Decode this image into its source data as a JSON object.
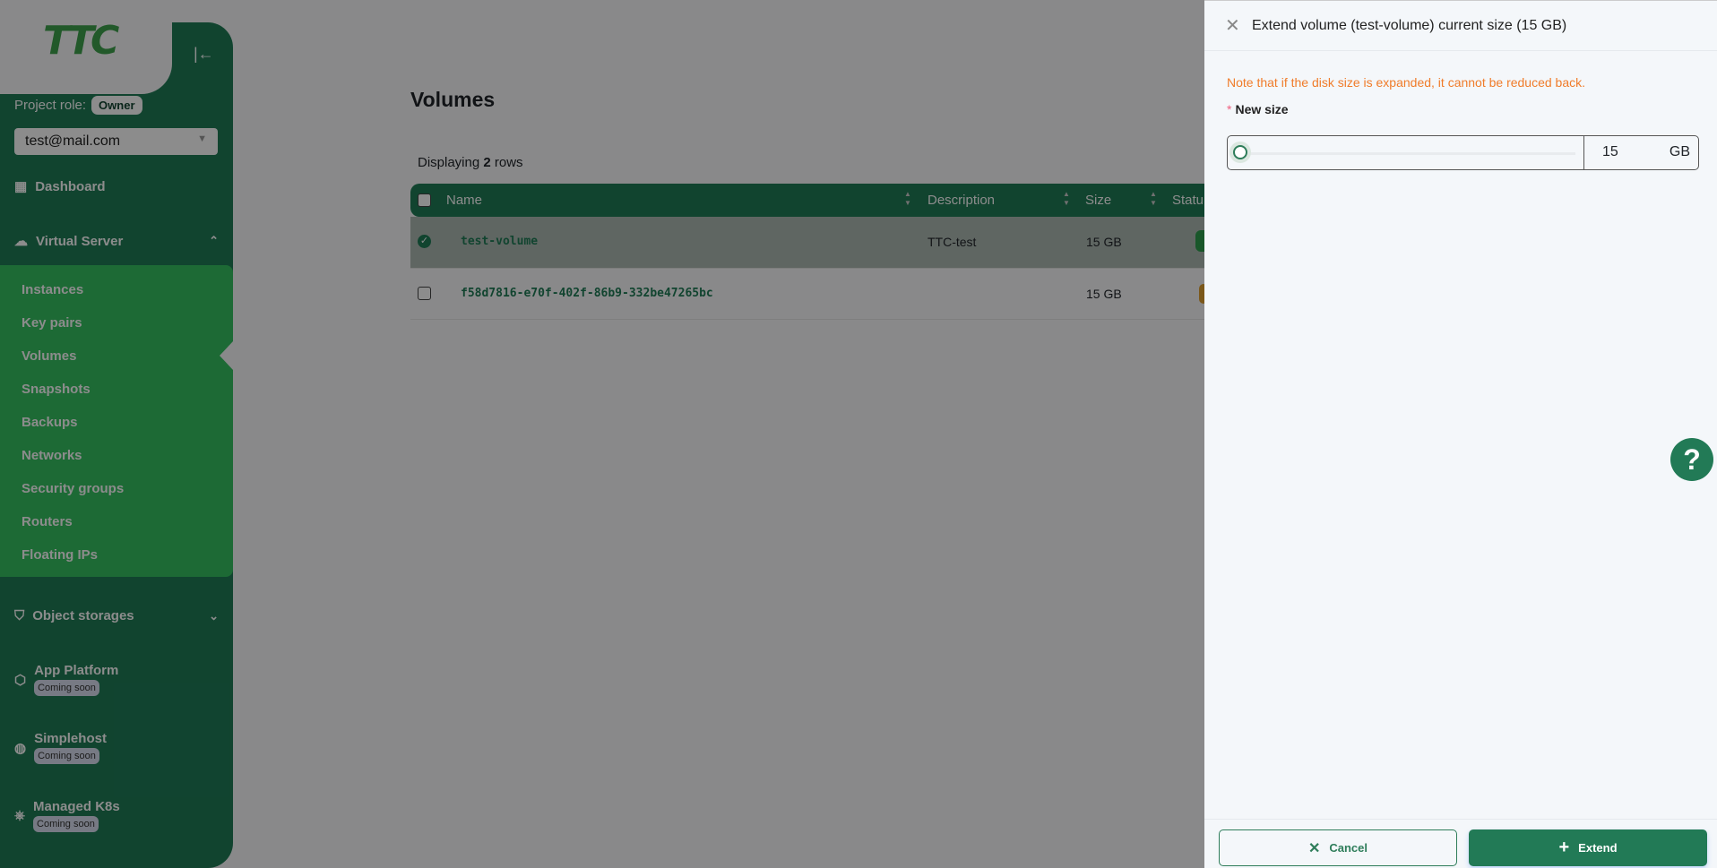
{
  "sidebar": {
    "logo": "TTC",
    "project_role_label": "Project role:",
    "project_role": "Owner",
    "account": "test@mail.com",
    "dashboard": "Dashboard",
    "virtual_server": "Virtual Server",
    "sub_items": [
      "Instances",
      "Key pairs",
      "Volumes",
      "Snapshots",
      "Backups",
      "Networks",
      "Security groups",
      "Routers",
      "Floating IPs"
    ],
    "object_storages": "Object storages",
    "app_platform": "App Platform",
    "simplehost": "Simplehost",
    "managed_k8s": "Managed K8s",
    "coming_soon": "Coming soon"
  },
  "main": {
    "title": "Volumes",
    "display_prefix": "Displaying",
    "display_count": "2",
    "display_suffix": "rows",
    "columns": [
      "Name",
      "Description",
      "Size",
      "Statu"
    ],
    "rows": [
      {
        "name": "test-volume",
        "description": "TTC-test",
        "size": "15 GB",
        "selected": true,
        "status_color": "#2e9e4e"
      },
      {
        "name": "f58d7816-e70f-402f-86b9-332be47265bc",
        "description": "",
        "size": "15 GB",
        "selected": false,
        "status_color": "#e0a030"
      }
    ]
  },
  "drawer": {
    "title": "Extend volume (test-volume) current size (15 GB)",
    "note": "Note that if the disk size is expanded, it cannot be reduced back.",
    "field_label": "New size",
    "value": "15",
    "unit": "GB",
    "slider_fraction": 0,
    "cancel": "Cancel",
    "extend": "Extend"
  },
  "colors": {
    "brand": "#227a56",
    "warning": "#f07c2a"
  }
}
